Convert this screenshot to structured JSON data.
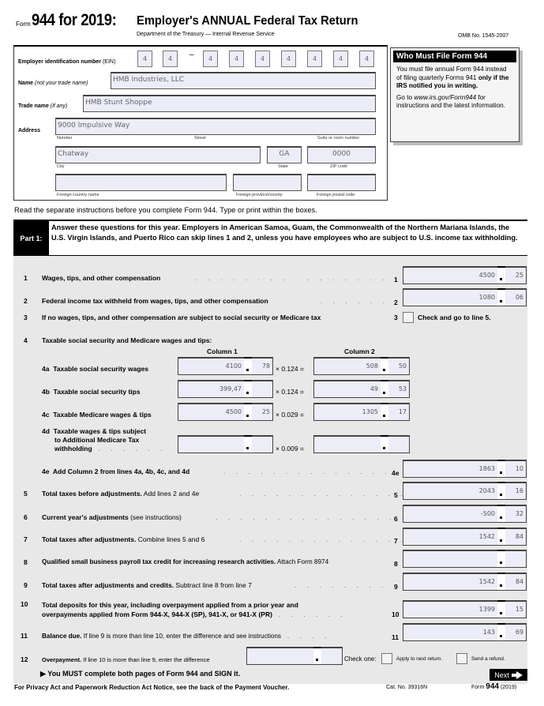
{
  "header": {
    "form_word": "Form",
    "form_number": "944 for 2019:",
    "title": "Employer's ANNUAL Federal Tax Return",
    "department": "Department of the Treasury — Internal Revenue Service",
    "omb": "OMB No. 1545-2007"
  },
  "employer": {
    "ein_label_bold": "Employer identification number",
    "ein_label_rest": " (EIN)",
    "ein_digits": [
      "4",
      "4",
      "4",
      "4",
      "4",
      "4",
      "4",
      "4",
      "4"
    ],
    "ein_dash": "–",
    "name_label_bold": "Name",
    "name_label_italic": " (not your trade name)",
    "name_value": "HMB Industries, LLC",
    "trade_label_bold": "Trade name",
    "trade_label_italic": " (if any)",
    "trade_value": "HMB Stunt Shoppe",
    "address_label": "Address",
    "street_value": "9000 Impulsive Way",
    "number_caption": "Number",
    "street_caption": "Street",
    "suite_caption": "Suite or room number",
    "city_value": "Chatway",
    "state_value": "GA",
    "zip_value": "0000",
    "city_caption": "City",
    "state_caption": "State",
    "zip_caption": "ZIP code",
    "foreign_country_value": "",
    "foreign_province_value": "",
    "foreign_postal_value": "",
    "foreign_country_caption": "Foreign country name",
    "foreign_province_caption": "Foreign province/county",
    "foreign_postal_caption": "Foreign postal code"
  },
  "who_must_file": {
    "title": "Who Must File Form 944",
    "p1": "You must file annual Form 944 instead of filing quarterly Forms 941",
    "p1_bold": "only if the IRS notified you in writing.",
    "p2_pre": "Go to ",
    "p2_link": "www.irs.gov/Form944",
    "p2_post": " for instructions and the latest information."
  },
  "read_separate": "Read the separate instructions before you complete Form 944. Type or print within the boxes.",
  "part1": {
    "label": "Part 1:",
    "text": "Answer these questions for this year. Employers in American Samoa, Guam, the Commonwealth of the Northern Mariana Islands, the U.S. Virgin Islands, and Puerto Rico can skip lines 1 and 2, unless you have employees who are subject to U.S. income tax withholding."
  },
  "lines": {
    "l1": {
      "num": "1",
      "bold": "Wages, tips, and other compensation",
      "rest": "",
      "dollars": "4500",
      "cents": "25"
    },
    "l2": {
      "num": "2",
      "bold": "Federal income tax withheld from wages, tips, and other compensation",
      "rest": "",
      "dollars": "1080",
      "cents": "06"
    },
    "l3": {
      "num": "3",
      "bold": "If no wages, tips, and other compensation are subject to social security or Medicare tax",
      "check_label": "Check and go to line 5.",
      "checked": false
    },
    "l4": {
      "num": "4",
      "bold": "Taxable social security and Medicare wages and tips:",
      "col1": "Column 1",
      "col2": "Column 2"
    },
    "l4a": {
      "num": "4a",
      "label": "Taxable social security wages",
      "c1_dollars": "4100",
      "c1_cents": "78",
      "mult": "× 0.124 =",
      "c2_dollars": "508",
      "c2_cents": "50"
    },
    "l4b": {
      "num": "4b",
      "label": "Taxable social security tips",
      "c1_dollars": "399,47",
      "c1_cents": "",
      "mult": "× 0.124 =",
      "c2_dollars": "49",
      "c2_cents": "53"
    },
    "l4c": {
      "num": "4c",
      "label": "Taxable Medicare wages & tips",
      "c1_dollars": "4500",
      "c1_cents": "25",
      "mult": "× 0.029 =",
      "c2_dollars": "1305",
      "c2_cents": "17"
    },
    "l4d": {
      "num": "4d",
      "label1": "Taxable wages & tips subject",
      "label2": "to Additional Medicare Tax",
      "label3": "withholding",
      "c1_dollars": "",
      "c1_cents": "",
      "mult": "× 0.009 =",
      "c2_dollars": "",
      "c2_cents": ""
    },
    "l4e": {
      "num": "4e",
      "bold": "Add Column 2 from lines 4a, 4b, 4c, and 4d",
      "dollars": "1863",
      "cents": "10"
    },
    "l5": {
      "num": "5",
      "bold": "Total taxes before adjustments.",
      "rest": " Add lines 2 and 4e",
      "dollars": "2043",
      "cents": "16"
    },
    "l6": {
      "num": "6",
      "bold": "Current year's adjustments",
      "rest": " (see instructions)",
      "dollars": "-500",
      "cents": "32"
    },
    "l7": {
      "num": "7",
      "bold": "Total taxes after adjustments.",
      "rest": " Combine lines 5 and 6",
      "dollars": "1542",
      "cents": "84"
    },
    "l8": {
      "num": "8",
      "bold": "Qualified small business payroll tax credit for increasing research activities.",
      "rest": " Attach Form 8974",
      "dollars": "",
      "cents": ""
    },
    "l9": {
      "num": "9",
      "bold": "Total taxes after adjustments and credits.",
      "rest": " Subtract line 8 from line 7",
      "dollars": "1542",
      "cents": "84"
    },
    "l10": {
      "num": "10",
      "bold1": "Total deposits for this year, including overpayment applied from a prior year and",
      "bold2": "overpayments applied from Form 944-X, 944-X (SP), 941-X, or 941-X (PR)",
      "dollars": "1399",
      "cents": "15"
    },
    "l11": {
      "num": "11",
      "bold": "Balance due.",
      "rest": " If line 9 is more than line 10, enter the difference and see instructions",
      "dollars": "143",
      "cents": "69"
    },
    "l12": {
      "num": "12",
      "bold": "Overpayment.",
      "rest": " If line 10 is more than line 9, enter the difference",
      "dollars": "",
      "cents": "",
      "check_one": "Check one:",
      "opt1": "Apply to next return.",
      "opt2": "Send a refund."
    }
  },
  "must_complete": "▶  You MUST complete both pages of Form 944 and SIGN it.",
  "next_button": "Next",
  "footer": {
    "privacy": "For Privacy Act and Paperwork Reduction Act Notice, see the back of the Payment Voucher.",
    "cat": "Cat. No. 39316N",
    "form_word": "Form",
    "form_num": "944",
    "year": "(2019)"
  }
}
